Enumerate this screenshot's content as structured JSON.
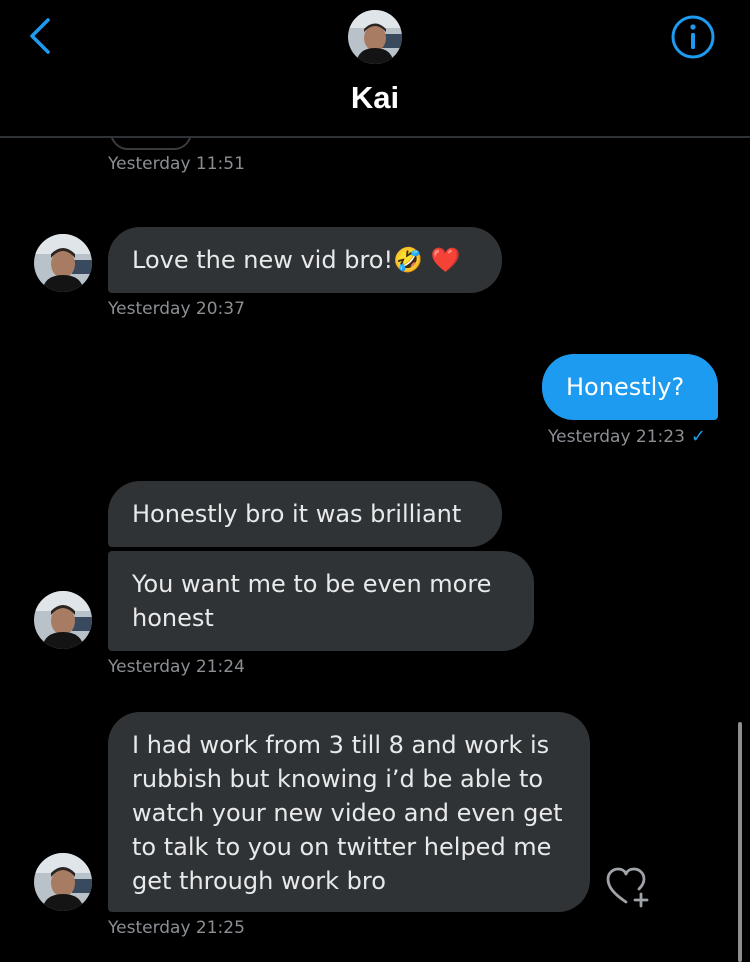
{
  "header": {
    "title": "Kai",
    "accent": "#1d9bf0"
  },
  "icons": {
    "back": "chevron-left-icon",
    "info": "info-circle-icon",
    "heart": "heart-plus-icon",
    "read": "checkmark-icon"
  },
  "messages": [
    {
      "id": "m0",
      "direction": "in",
      "text": "",
      "timestamp": "Yesterday 11:51"
    },
    {
      "id": "m1",
      "direction": "in",
      "text": "Love the new vid bro!",
      "emoji": "🤣 ❤️",
      "timestamp": "Yesterday 20:37"
    },
    {
      "id": "m2",
      "direction": "out",
      "text": "Honestly?",
      "timestamp": "Yesterday 21:23",
      "read_mark": "✓"
    },
    {
      "id": "m3",
      "direction": "in",
      "text": "Honestly bro it was brilliant"
    },
    {
      "id": "m4",
      "direction": "in",
      "text": "You want me to be even more honest",
      "timestamp": "Yesterday 21:24"
    },
    {
      "id": "m5",
      "direction": "in",
      "text": "I had work from 3 till 8 and work is rubbish but knowing i’d be able to watch your new video and even get to talk to you on twitter helped me get through work bro",
      "timestamp": "Yesterday 21:25"
    }
  ],
  "colors": {
    "incoming_bubble": "#2f3336",
    "outgoing_bubble": "#1d9bf0",
    "timestamp": "#8b8f94",
    "background": "#000000"
  }
}
